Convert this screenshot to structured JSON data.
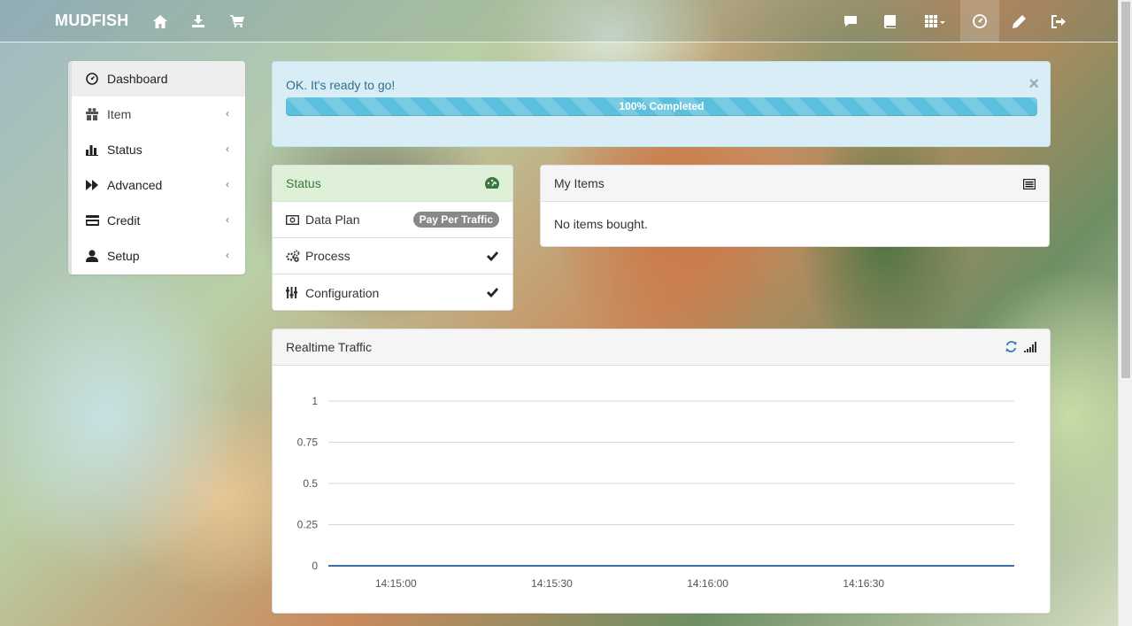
{
  "navbar": {
    "brand": "MUDFISH",
    "left_icons": [
      "home-icon",
      "download-icon",
      "cart-icon"
    ],
    "right_icons": [
      "comment-icon",
      "book-icon",
      "grid-icon",
      "dashboard-icon",
      "pencil-icon",
      "logout-icon"
    ]
  },
  "sidebar": {
    "items": [
      {
        "label": "Dashboard",
        "icon": "dashboard-icon"
      },
      {
        "label": "Item",
        "icon": "gift-icon"
      },
      {
        "label": "Status",
        "icon": "stats-icon"
      },
      {
        "label": "Advanced",
        "icon": "forward-icon"
      },
      {
        "label": "Credit",
        "icon": "credit-card-icon"
      },
      {
        "label": "Setup",
        "icon": "user-icon"
      }
    ],
    "chevron": "‹"
  },
  "alert": {
    "message": "OK. It's ready to go!",
    "close": "×",
    "progress_percent": 100,
    "progress_label": "100% Completed"
  },
  "status_panel": {
    "title": "Status",
    "rows": [
      {
        "label": "Data Plan",
        "badge": "Pay Per Traffic"
      },
      {
        "label": "Process"
      },
      {
        "label": "Configuration"
      }
    ]
  },
  "items_panel": {
    "title": "My Items",
    "empty_text": "No items bought."
  },
  "traffic_panel": {
    "title": "Realtime Traffic"
  },
  "colors": {
    "alert_bg": "#d9edf7",
    "alert_text": "#31708f",
    "progress": "#5bc0de",
    "status_head_bg": "#dff0d8",
    "status_head_text": "#3c763d",
    "badge": "#888888",
    "line": "#3a6fa8"
  },
  "chart_data": {
    "type": "line",
    "title": "",
    "xlabel": "",
    "ylabel": "",
    "ylim": [
      0,
      1
    ],
    "yticks": [
      "1",
      "0.75",
      "0.5",
      "0.25",
      "0"
    ],
    "yticks_values": [
      1,
      0.75,
      0.5,
      0.25,
      0
    ],
    "xticks": [
      "14:15:00",
      "14:15:30",
      "14:16:00",
      "14:16:30"
    ],
    "grid": true,
    "series": [
      {
        "x": [
          "14:14:47",
          "14:15:00",
          "14:15:30",
          "14:16:00",
          "14:16:30",
          "14:16:59"
        ],
        "values": [
          0,
          0,
          0,
          0,
          0,
          0
        ]
      }
    ]
  }
}
